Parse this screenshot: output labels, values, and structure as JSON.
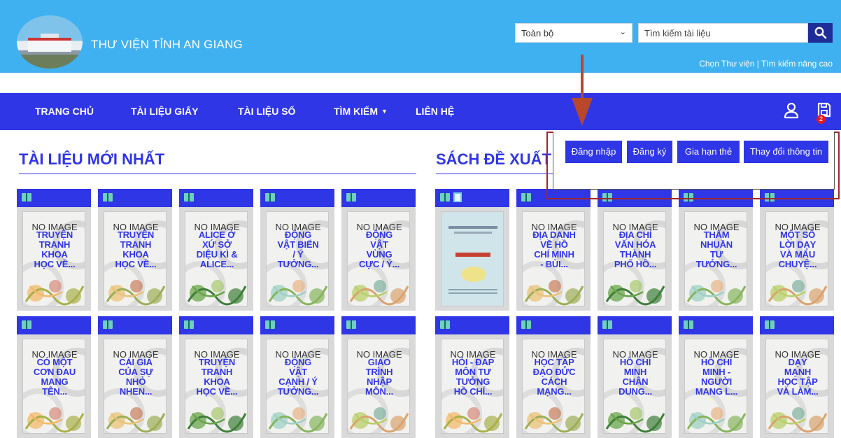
{
  "header": {
    "site_title": "THƯ VIỆN TỈNH AN GIANG",
    "scope_select_value": "Toàn bộ",
    "search_placeholder": "Tìm kiếm tài liệu",
    "links_text": "Chọn Thư viện | Tìm kiếm nâng cao"
  },
  "nav": {
    "items": [
      "TRANG CHỦ",
      "TÀI LIỆU GIẤY",
      "TÀI LIỆU SỐ",
      "TÌM KIẾM",
      "LIÊN HỆ"
    ],
    "cart_count": "2"
  },
  "account_menu": {
    "items": [
      "Đăng nhập",
      "Đăng ký",
      "Gia hạn thẻ",
      "Thay đổi thông tin"
    ]
  },
  "sections": {
    "newest_title": "TÀI LIỆU MỚI NHẤT",
    "suggested_title": "SÁCH ĐỀ XUẤT"
  },
  "no_image_text": "NO IMAGE",
  "newest_books": [
    [
      "TRUYỆN",
      "TRANH",
      "KHOA",
      "HỌC VỀ..."
    ],
    [
      "TRUYỆN",
      "TRANH",
      "KHOA",
      "HỌC VỀ..."
    ],
    [
      "ALICE Ở",
      "XỨ SỞ",
      "DIỆU KÌ &",
      "ALICE..."
    ],
    [
      "ĐỘNG",
      "VẬT BIỂN",
      "/ Ý",
      "TƯỞNG..."
    ],
    [
      "ĐỘNG",
      "VẬT",
      "VÙNG",
      "CỰC / Ý..."
    ],
    [
      "CÓ MỘT",
      "CƠN ĐAU",
      "MANG",
      "TÊN..."
    ],
    [
      "CÁI GIÁ",
      "CỦA SỰ",
      "NHỎ",
      "NHEN..."
    ],
    [
      "TRUYỆN",
      "TRANH",
      "KHOA",
      "HỌC VỀ..."
    ],
    [
      "ĐỘNG",
      "VẬT",
      "CẠNH / Ý",
      "TƯỞNG..."
    ],
    [
      "GIÁO",
      "TRÌNH",
      "NHẬP",
      "MÔN..."
    ]
  ],
  "suggested_books": [
    [],
    [
      "ĐỊA DANH",
      "VỀ HỒ",
      "CHÍ MINH",
      "- BÙI..."
    ],
    [
      "ĐỊA CHỈ",
      "VĂN HÓA",
      "THÀNH",
      "PHỐ HỒ..."
    ],
    [
      "THẤM",
      "NHUẦN",
      "TƯ",
      "TƯỞNG..."
    ],
    [
      "MỘT SỐ",
      "LỜI DẠY",
      "VÀ MẨU",
      "CHUYỆ..."
    ],
    [
      "HỎI - ĐÁP",
      "MÔN TƯ",
      "TƯỞNG",
      "HỒ CHÍ..."
    ],
    [
      "HỌC TẬP",
      "ĐẠO ĐỨC",
      "CÁCH",
      "MẠNG..."
    ],
    [
      "HỒ CHÍ",
      "MINH",
      "CHÂN",
      "DUNG..."
    ],
    [
      "HỒ CHÍ",
      "MINH -",
      "NGƯỜI",
      "MANG L..."
    ],
    [
      "DẠY",
      "MẠNH",
      "HỌC TẬP",
      "VÀ LÀM..."
    ]
  ],
  "icons": [
    "search-icon",
    "chevron-down-icon",
    "user-icon",
    "save-icon",
    "book-icon",
    "document-icon",
    "down-arrow-icon"
  ]
}
